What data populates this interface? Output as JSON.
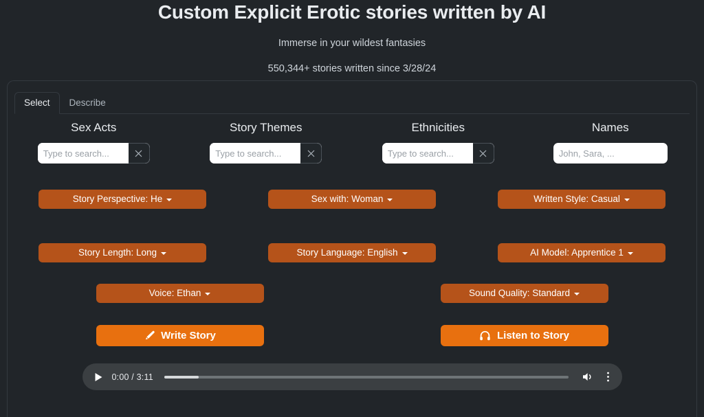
{
  "header": {
    "title": "Custom Explicit Erotic stories written by AI",
    "subtitle": "Immerse in your wildest fantasies",
    "stat_line": "550,344+ stories written since 3/28/24"
  },
  "tabs": [
    {
      "label": "Select",
      "active": true
    },
    {
      "label": "Describe",
      "active": false
    }
  ],
  "columns": [
    {
      "heading": "Sex Acts",
      "placeholder": "Type to search...",
      "value": "",
      "has_clear": true
    },
    {
      "heading": "Story Themes",
      "placeholder": "Type to search...",
      "value": "",
      "has_clear": true
    },
    {
      "heading": "Ethnicities",
      "placeholder": "Type to search...",
      "value": "",
      "has_clear": true
    },
    {
      "heading": "Names",
      "placeholder": "John, Sara, ...",
      "value": "",
      "has_clear": false
    }
  ],
  "dropdowns_row1": [
    {
      "label": "Story Perspective: He"
    },
    {
      "label": "Sex with: Woman"
    },
    {
      "label": "Written Style: Casual"
    }
  ],
  "dropdowns_row2": [
    {
      "label": "Story Length: Long"
    },
    {
      "label": "Story Language: English"
    },
    {
      "label": "AI Model: Apprentice 1"
    }
  ],
  "dropdowns_row3": [
    {
      "label": "Voice: Ethan"
    },
    {
      "label": "Sound Quality: Standard"
    }
  ],
  "actions": [
    {
      "label": "Write Story",
      "icon": "pen-icon"
    },
    {
      "label": "Listen to Story",
      "icon": "headphones-icon"
    }
  ],
  "audio": {
    "time_display": "0:00 / 3:11",
    "current_time": "0:00",
    "duration": "3:11",
    "progress_percent": 0,
    "play_icon": "play-icon",
    "volume_icon": "volume-icon",
    "menu_icon": "more-vertical-icon"
  },
  "colors": {
    "page_background": "#212529",
    "panel_border": "#343a40",
    "dropdown_orange": "#b5531a",
    "action_orange": "#e8700f",
    "text_primary": "#e9ecef",
    "text_muted": "#ced4da",
    "player_background": "#3b3f42"
  }
}
